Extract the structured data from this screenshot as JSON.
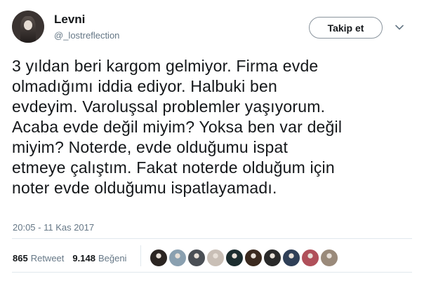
{
  "user": {
    "display_name": "Levni",
    "handle": "@_lostreflection"
  },
  "follow_button": {
    "label": "Takip et"
  },
  "tweet": {
    "lines": [
      "3 yıldan beri kargom gelmiyor. Firma evde",
      "olmadığımı iddia ediyor. Halbuki ben",
      "evdeyim. Varoluşsal problemler yaşıyorum.",
      "Acaba evde değil miyim? Yoksa ben var değil",
      "miyim? Noterde, evde olduğumu ispat",
      "etmeye çalıştım. Fakat noterde olduğum için",
      "noter evde olduğumu ispatlayamadı."
    ],
    "timestamp": "20:05 - 11 Kas 2017"
  },
  "stats": {
    "retweets": {
      "count": "865",
      "label": "Retweet"
    },
    "likes": {
      "count": "9.148",
      "label": "Beğeni"
    }
  },
  "likers": [
    {
      "icon": "avatar",
      "color": "#2b2522"
    },
    {
      "icon": "avatar",
      "color": "#8aa0b0"
    },
    {
      "icon": "avatar",
      "color": "#4a4f55"
    },
    {
      "icon": "avatar",
      "color": "#c9bfb6"
    },
    {
      "icon": "avatar",
      "color": "#1c2d2f"
    },
    {
      "icon": "avatar",
      "color": "#3b2a1f"
    },
    {
      "icon": "avatar",
      "color": "#2a2a2a"
    },
    {
      "icon": "avatar",
      "color": "#2f3f57"
    },
    {
      "icon": "avatar",
      "color": "#b0505a"
    },
    {
      "icon": "avatar",
      "color": "#9a8a7a"
    }
  ],
  "colors": {
    "text": "#14171a",
    "muted": "#657786",
    "border": "#e1e8ed"
  }
}
